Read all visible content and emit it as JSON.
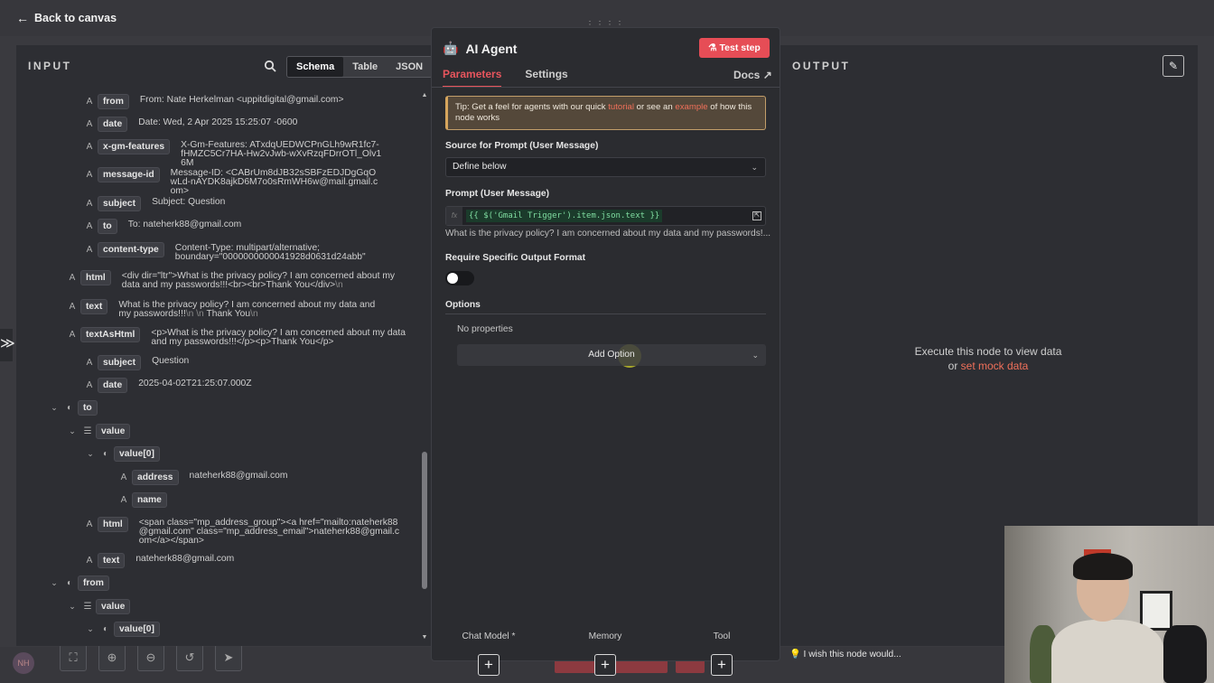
{
  "topbar": {
    "back_label": "Back to canvas"
  },
  "input": {
    "title": "INPUT",
    "view_tabs": [
      "Schema",
      "Table",
      "JSON"
    ],
    "active_view": "Schema",
    "rows": [
      {
        "type": "A",
        "key": "from",
        "value": "From: Nate Herkelman <uppitdigital@gmail.com>"
      },
      {
        "type": "A",
        "key": "date",
        "value": "Date: Wed, 2 Apr 2025 15:25:07 -0600"
      },
      {
        "type": "A",
        "key": "x-gm-features",
        "value": "X-Gm-Features: ATxdqUEDWCPnGLh9wR1fc7-fHMZC5Cr7HA-Hw2vJwb-wXvRzqFDrrOTl_Olv16M"
      },
      {
        "type": "A",
        "key": "message-id",
        "value": "Message-ID: <CABrUm8dJB32sSBFzEDJDgGqOwLd-nAYDK8ajkD6M7o0sRmWH6w@mail.gmail.com>"
      },
      {
        "type": "A",
        "key": "subject",
        "value": "Subject: Question"
      },
      {
        "type": "A",
        "key": "to",
        "value": "To: nateherk88@gmail.com"
      },
      {
        "type": "A",
        "key": "content-type",
        "value": "Content-Type: multipart/alternative; boundary=\"0000000000041928d0631d24abb\""
      },
      {
        "type": "A",
        "key": "html",
        "value": "<div dir=\"ltr\">What is the privacy policy? I am concerned about my data and my passwords!!!<br><br>Thank You</div>",
        "suffix": "\\n"
      },
      {
        "type": "A",
        "key": "text",
        "value": "What is the privacy policy? I am concerned about my data and my passwords!!!",
        "mid": "\\n \\n",
        "tail": "Thank You",
        "suffix": "\\n"
      },
      {
        "type": "A",
        "key": "textAsHtml",
        "value": "<p>What is the privacy policy? I am concerned about my data and my passwords!!!</p><p>Thank You</p>"
      },
      {
        "type": "A",
        "key": "subject",
        "value": "Question"
      },
      {
        "type": "A",
        "key": "date",
        "value": "2025-04-02T21:25:07.000Z"
      },
      {
        "type": "obj",
        "key": "to",
        "value": ""
      },
      {
        "type": "list",
        "key": "value",
        "value": ""
      },
      {
        "type": "obj",
        "key": "value[0]",
        "value": ""
      },
      {
        "type": "A",
        "key": "address",
        "value": "nateherk88@gmail.com"
      },
      {
        "type": "A",
        "key": "name",
        "value": ""
      },
      {
        "type": "A",
        "key": "html",
        "value": "<span class=\"mp_address_group\"><a href=\"mailto:nateherk88@gmail.com\" class=\"mp_address_email\">nateherk88@gmail.com</a></span>"
      },
      {
        "type": "A",
        "key": "text",
        "value": "nateherk88@gmail.com"
      },
      {
        "type": "obj",
        "key": "from",
        "value": ""
      },
      {
        "type": "list",
        "key": "value",
        "value": ""
      },
      {
        "type": "obj",
        "key": "value[0]",
        "value": ""
      }
    ]
  },
  "node": {
    "title": "AI Agent",
    "test_step": "Test step",
    "tabs": [
      "Parameters",
      "Settings"
    ],
    "docs": "Docs",
    "tip": {
      "prefix": "Tip: Get a feel for agents with our quick ",
      "link1": "tutorial",
      "mid": " or see an ",
      "link2": "example",
      "suffix": " of how this node works"
    },
    "source_label": "Source for Prompt (User Message)",
    "source_value": "Define below",
    "prompt_label": "Prompt (User Message)",
    "prompt_fx": "fx",
    "prompt_expression": "{{ $('Gmail Trigger').item.json.text }}",
    "prompt_preview": "What is the privacy policy? I am concerned about my data and my passwords!...",
    "require_format_label": "Require Specific Output Format",
    "require_format_on": false,
    "options_label": "Options",
    "no_properties": "No properties",
    "add_option": "Add Option",
    "connectors": [
      {
        "label": "Chat Model *"
      },
      {
        "label": "Memory"
      },
      {
        "label": "Tool"
      }
    ]
  },
  "output": {
    "title": "OUTPUT",
    "exec_text": "Execute this node to view data",
    "or": "or",
    "mock_link": "set mock data"
  },
  "footer": {
    "wish": "I wish this node would..."
  },
  "colors": {
    "accent": "#e8555d",
    "background": "#2d2e33",
    "tip_border": "#d6a55d"
  }
}
